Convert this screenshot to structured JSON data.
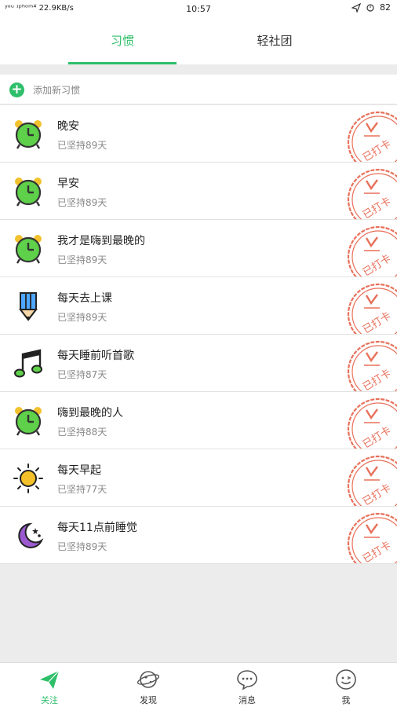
{
  "status_bar": {
    "signal": "ʸᵒᵘ ᶦᵖʰᵒᵐ⁴ 22.9KB/s",
    "time": "10:57",
    "battery": "82"
  },
  "tabs": [
    {
      "label": "习惯",
      "active": true
    },
    {
      "label": "轻社团",
      "active": false
    }
  ],
  "add_habit": {
    "label": "添加新习惯"
  },
  "habits": [
    {
      "title": "晚安",
      "subtitle": "已坚持89天",
      "icon": "alarm-clock-icon",
      "stamp": "已打卡"
    },
    {
      "title": "早安",
      "subtitle": "已坚持89天",
      "icon": "alarm-clock-icon",
      "stamp": "已打卡"
    },
    {
      "title": "我才是嗨到最晚的",
      "subtitle": "已坚持89天",
      "icon": "alarm-clock-icon",
      "stamp": "已打卡"
    },
    {
      "title": "每天去上课",
      "subtitle": "已坚持89天",
      "icon": "pencil-icon",
      "stamp": "已打卡"
    },
    {
      "title": "每天睡前听首歌",
      "subtitle": "已坚持87天",
      "icon": "music-note-icon",
      "stamp": "已打卡"
    },
    {
      "title": "嗨到最晚的人",
      "subtitle": "已坚持88天",
      "icon": "alarm-clock-icon",
      "stamp": "已打卡"
    },
    {
      "title": "每天早起",
      "subtitle": "已坚持77天",
      "icon": "sun-icon",
      "stamp": "已打卡"
    },
    {
      "title": "每天11点前睡觉",
      "subtitle": "已坚持89天",
      "icon": "moon-stars-icon",
      "stamp": "已打卡"
    }
  ],
  "bottom_nav": [
    {
      "label": "关注",
      "icon": "paper-plane-icon",
      "active": true
    },
    {
      "label": "发现",
      "icon": "planet-icon",
      "active": false
    },
    {
      "label": "消息",
      "icon": "chat-bubble-icon",
      "active": false
    },
    {
      "label": "我",
      "icon": "smiley-face-icon",
      "active": false
    }
  ],
  "colors": {
    "accent": "#2fbf6a",
    "stamp": "#e8705a"
  }
}
